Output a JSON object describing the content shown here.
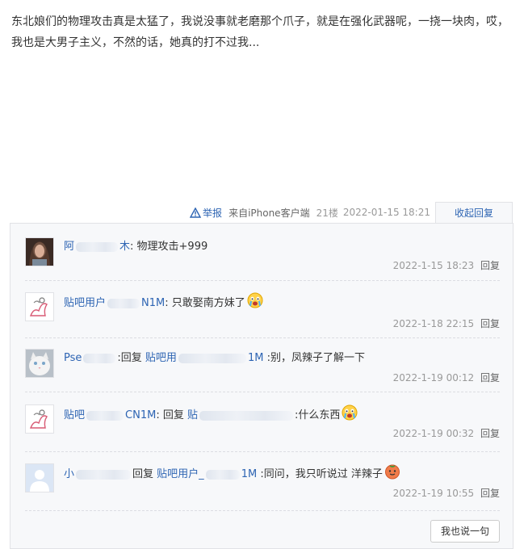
{
  "post": {
    "text": "东北娘们的物理攻击真是太猛了，我说没事就老磨那个爪子，就是在强化武器呢，一挠一块肉，哎，我也是大男子主义，不然的话，她真的打不过我..."
  },
  "tail": {
    "report_label": "举报",
    "source": "来自iPhone客户端",
    "floor": "21楼",
    "date": "2022-01-15 18:21",
    "collapse_label": "收起回复"
  },
  "replies": [
    {
      "user_a": "阿",
      "user_b": "木",
      "text": ": 物理攻击+999",
      "time": "2022-1-15 18:23",
      "reply_label": "回复",
      "avatar_icon": "photo-avatar-icon"
    },
    {
      "user_a": "贴吧用户",
      "user_b": "N1M",
      "text": ": 只敢娶南方妹了",
      "time": "2022-1-18 22:15",
      "reply_label": "回复",
      "emoji": "crying-face-icon"
    },
    {
      "user_a": "Pse",
      "mid": ":回复",
      "target_a": "贴吧用",
      "target_b": "1M",
      "text": ":别，凤辣子了解一下",
      "time": "2022-1-19 00:12",
      "reply_label": "回复",
      "avatar_icon": "white-cat-avatar-icon"
    },
    {
      "user_a": "贴吧",
      "user_b": "CN1M",
      "mid": ": 回复",
      "target_a": "贴",
      "text": ":什么东西",
      "time": "2022-1-19 00:32",
      "reply_label": "回复",
      "emoji": "crying-face-icon"
    },
    {
      "user_a": "小",
      "mid": "回复",
      "target_a": "贴吧用户_",
      "target_b": "1M",
      "text": ":同问，我只听说过 洋辣子",
      "time": "2022-1-19 10:55",
      "reply_label": "回复",
      "emoji": "tomato-face-icon"
    }
  ],
  "say_button": "我也说一句",
  "colors": {
    "link": "#2d64b3",
    "meta": "#999999",
    "panel": "#f7f8fa",
    "border": "#e1e2e6"
  }
}
